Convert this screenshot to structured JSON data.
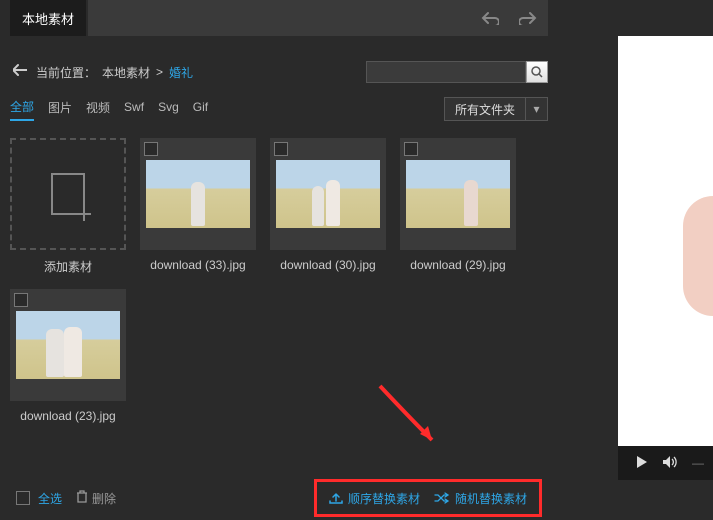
{
  "tab": {
    "active": "本地素材"
  },
  "breadcrumb": {
    "label": "当前位置：",
    "root": "本地素材",
    "sep": ">",
    "leaf": "婚礼"
  },
  "filters": [
    "全部",
    "图片",
    "视频",
    "Swf",
    "Svg",
    "Gif"
  ],
  "folder_select": "所有文件夹",
  "tiles": {
    "add": "添加素材",
    "items": [
      "download (33).jpg",
      "download (30).jpg",
      "download (29).jpg",
      "download (23).jpg"
    ]
  },
  "bottom": {
    "select_all": "全选",
    "delete": "删除"
  },
  "actions": {
    "seq": "顺序替换素材",
    "rand": "随机替换素材"
  }
}
